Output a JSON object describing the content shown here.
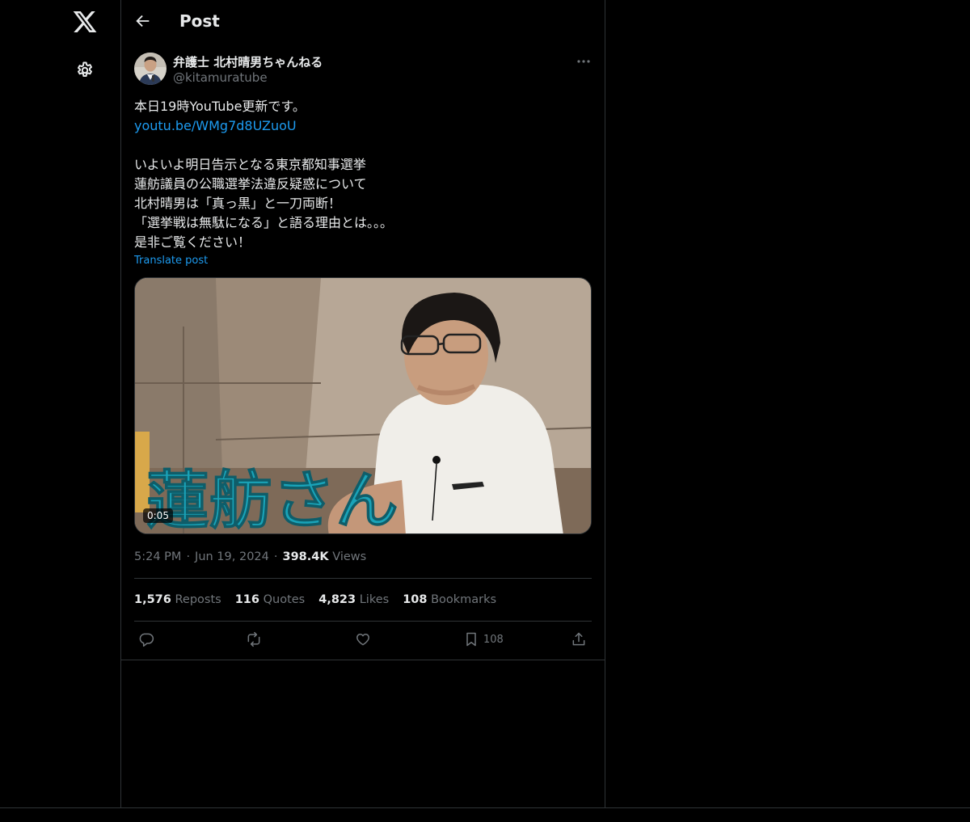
{
  "header": {
    "title": "Post"
  },
  "author": {
    "name": "弁護士 北村晴男ちゃんねる",
    "handle": "@kitamuratube"
  },
  "tweet": {
    "line1": "本日19時YouTube更新です。",
    "link": "youtu.be/WMg7d8UZuoU",
    "line3": "いよいよ明日告示となる東京都知事選挙",
    "line4": "蓮舫議員の公職選挙法違反疑惑について",
    "line5": "北村晴男は「真っ黒」と一刀両断！",
    "line6": "「選挙戦は無駄になる」と語る理由とは。。。",
    "line7": "是非ご覧ください！",
    "translate_label": "Translate post"
  },
  "media": {
    "overlay_text": "蓮舫さん",
    "duration": "0:05"
  },
  "meta": {
    "time": "5:24 PM",
    "date": "Jun 19, 2024",
    "views_count": "398.4K",
    "views_label": "Views"
  },
  "stats": {
    "reposts_count": "1,576",
    "reposts_label": "Reposts",
    "quotes_count": "116",
    "quotes_label": "Quotes",
    "likes_count": "4,823",
    "likes_label": "Likes",
    "bookmarks_count": "108",
    "bookmarks_label": "Bookmarks"
  },
  "actions": {
    "bookmark_count": "108"
  },
  "icons": {
    "nav": [
      "x-logo-icon",
      "gear-icon"
    ],
    "header": [
      "back-arrow-icon"
    ],
    "post": [
      "more-icon",
      "reply-icon",
      "repost-icon",
      "like-icon",
      "bookmark-icon",
      "share-icon"
    ]
  },
  "colors": {
    "background": "#000000",
    "text": "#e7e9ea",
    "secondary_text": "#71767b",
    "link": "#1d9bf0",
    "border": "#2f3336",
    "overlay_text": "#1aa3b8"
  }
}
